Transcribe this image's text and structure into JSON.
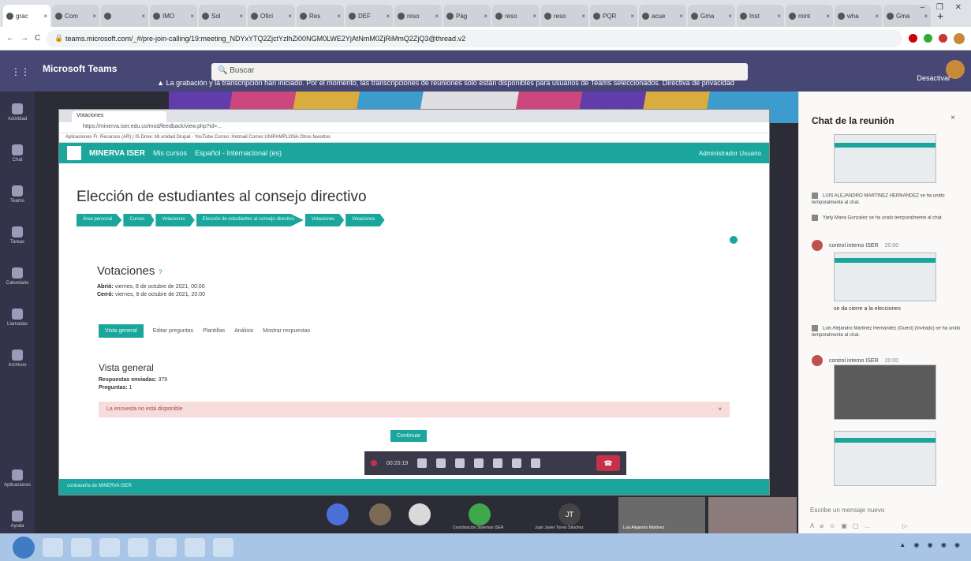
{
  "browser": {
    "tabs": [
      {
        "label": "grac"
      },
      {
        "label": "Com"
      },
      {
        "label": ""
      },
      {
        "label": "IMO"
      },
      {
        "label": "Sol"
      },
      {
        "label": "Ofici"
      },
      {
        "label": "Res"
      },
      {
        "label": "DEF"
      },
      {
        "label": "reso"
      },
      {
        "label": "Pág"
      },
      {
        "label": "reso"
      },
      {
        "label": "reso"
      },
      {
        "label": "PQR"
      },
      {
        "label": "acue"
      },
      {
        "label": "Gma"
      },
      {
        "label": "Inst"
      },
      {
        "label": "mint"
      },
      {
        "label": "wha"
      },
      {
        "label": "Gma"
      }
    ],
    "url": "teams.microsoft.com/_#/pre-join-calling/19:meeting_NDYxYTQ2ZjctYzlhZi00NGM0LWE2YjAtNmM0ZjRiMmQ2ZjQ3@thread.v2",
    "colors": {
      "chrome": "#dee1e6"
    }
  },
  "teams": {
    "app_name": "Microsoft Teams",
    "search_placeholder": "Buscar",
    "notice": "La grabación y la transcripción han iniciado. Por el momento, las transcripciones de reuniones solo están disponibles para usuarios de Teams seleccionados. Directiva de privacidad",
    "leave_label": "Desactivar",
    "rail": [
      {
        "label": "Actividad",
        "icon": "bell-icon"
      },
      {
        "label": "Chat",
        "icon": "chat-icon"
      },
      {
        "label": "Teams",
        "icon": "teams-icon"
      },
      {
        "label": "Tareas",
        "icon": "tasks-icon"
      },
      {
        "label": "Calendario",
        "icon": "calendar-icon"
      },
      {
        "label": "Llamadas",
        "icon": "phone-icon"
      },
      {
        "label": "Archivos",
        "icon": "files-icon"
      }
    ],
    "rail_bottom": [
      {
        "label": "Aplicaciones",
        "icon": "apps-icon"
      },
      {
        "label": "Ayuda",
        "icon": "help-icon"
      }
    ],
    "colors": {
      "header": "#464775",
      "hangup": "#c4314b"
    }
  },
  "shared": {
    "tab_label": "Votaciones",
    "address": "https://minerva.iser.edu.co/mod/feedback/view.php?id=...",
    "bookmarks": "Aplicaciones   Fr. Recursos (AR) | IS   Drive: Mi unidad   Drupal - YouTube   Correo: Hotmail   Correo UNIPAMPLONA   Otros favoritos",
    "site_name": "MINERVA ISER",
    "nav_items": [
      "Mis cursos",
      "Español - Internacional (es)"
    ],
    "admin_label": "Administrador Usuario",
    "page_title": "Elección de estudiantes al consejo directivo",
    "breadcrumbs": [
      "Área personal",
      "Cursos",
      "Votaciones",
      "Elección de estudiantes al consejo directivo",
      "Votaciones",
      "Votaciones"
    ],
    "activity_title": "Votaciones",
    "opened_label": "Abrió:",
    "opened_value": "viernes, 8 de octubre de 2021, 00:00",
    "closed_label": "Cerró:",
    "closed_value": "viernes, 8 de octubre de 2021, 20:00",
    "tabs": [
      "Vista general",
      "Editar preguntas",
      "Plantillas",
      "Análisis",
      "Mostrar respuestas"
    ],
    "overview_title": "Vista general",
    "responses_label": "Respuestas enviadas:",
    "responses_value": "379",
    "questions_label": "Preguntas:",
    "questions_value": "1",
    "alert": "La encuesta no está disponible",
    "alert_close": "×",
    "continue_label": "Continuar",
    "footer": "contraseña de MINERVA ISER",
    "colors": {
      "accent": "#1aa69c",
      "alert_bg": "#f7dcdc"
    }
  },
  "call": {
    "timer": "00:20:19"
  },
  "participants": [
    {
      "name": "",
      "color": "#4a6fd6"
    },
    {
      "name": "",
      "color": "#7b6a55"
    },
    {
      "name": "",
      "color": "#d9d9d9"
    },
    {
      "name": "Coordinación Sistemas ISER",
      "color": "#3ea84b"
    },
    {
      "name": "Juan Javier Torres Sánchez",
      "initials": "JT",
      "color": "#444"
    },
    {
      "name": "Luis Alejandro Martínez",
      "color": "#6b6a6a"
    }
  ],
  "chat": {
    "title": "Chat de la reunión",
    "close": "×",
    "system_messages": [
      {
        "text": "LUIS ALEJANDRO MARTINEZ HERNANDEZ se ha unido temporalmente al chat."
      },
      {
        "text": "Yarly Maria Gonzalez se ha unido temporalmente al chat."
      },
      {
        "text": "Luis Alejandro Martinez Hernandez (Guest) (Invitado) se ha unido temporalmente al chat."
      }
    ],
    "messages": [
      {
        "sender": "control interno ISER",
        "time": "20:00"
      },
      {
        "text": "se da cierre a la elecciones"
      },
      {
        "sender": "control interno ISER",
        "time": "20:00"
      }
    ],
    "compose_placeholder": "Escribe un mensaje nuevo"
  }
}
